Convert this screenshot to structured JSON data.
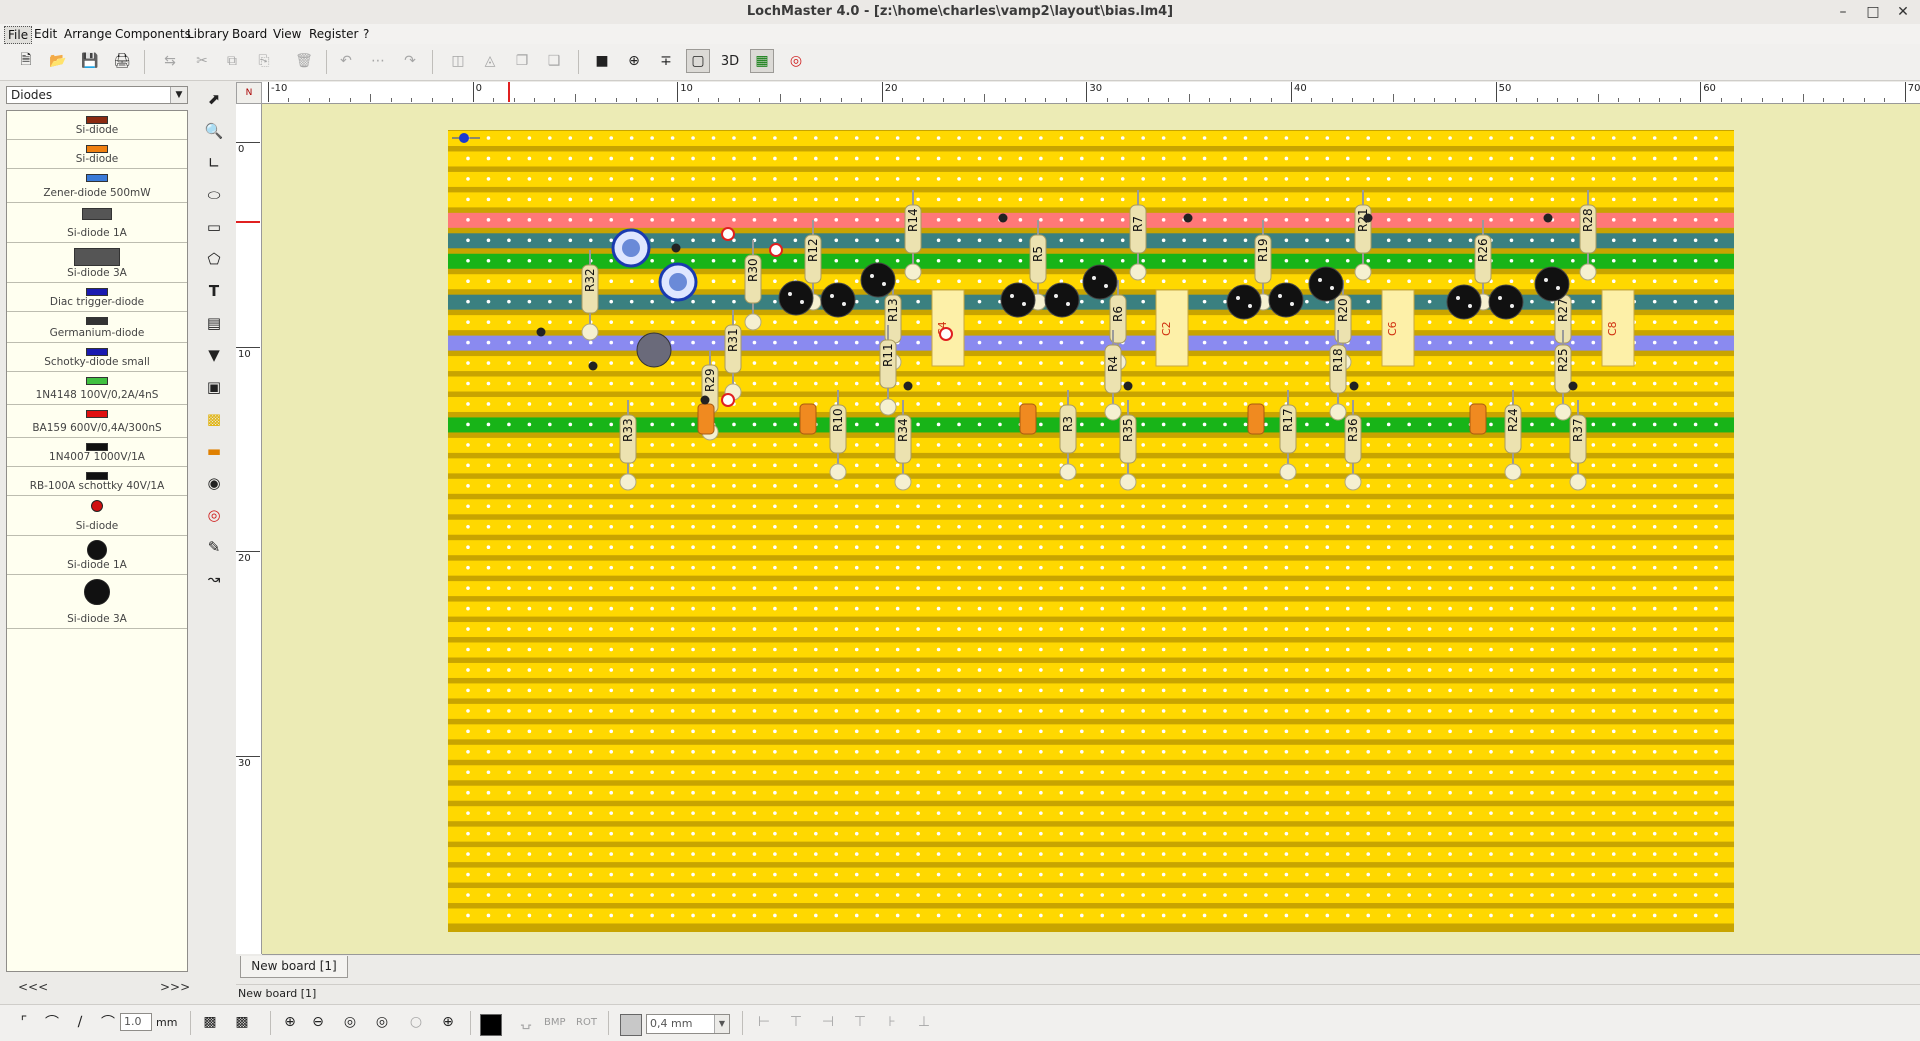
{
  "window": {
    "title": "LochMaster 4.0 - [z:\\home\\charles\\vamp2\\layout\\bias.lm4]",
    "minimize": "–",
    "restore": "□",
    "close": "✕"
  },
  "menu": [
    "File",
    "Edit",
    "Arrange",
    "Components",
    "Library",
    "Board",
    "View",
    "Register",
    "?"
  ],
  "toolbar": {
    "three_d_label": "3D"
  },
  "library": {
    "category": "Diodes",
    "items": [
      {
        "ref": "D1",
        "label": "Si-diode",
        "color": "#8b2a10"
      },
      {
        "ref": "D2",
        "label": "Si-diode",
        "color": "#f08010"
      },
      {
        "ref": "D3",
        "label": "Zener-diode 500mW",
        "color": "#3a7ad8"
      },
      {
        "ref": "D4",
        "label": "Si-diode 1A",
        "color": "#555555"
      },
      {
        "ref": "D5",
        "label": "Si-diode 3A",
        "color": "#555555"
      },
      {
        "ref": "D6",
        "label": "Diac trigger-diode",
        "color": "#1a1ab0"
      },
      {
        "ref": "D7",
        "label": "Germanium-diode",
        "color": "#333333"
      },
      {
        "ref": "D8",
        "label": "Schotky-diode small",
        "color": "#1a1ab0"
      },
      {
        "ref": "D9",
        "label": "1N4148  100V/0,2A/4nS",
        "color": "#40c040"
      },
      {
        "ref": "D10",
        "label": "BA159 600V/0,4A/300nS",
        "color": "#e01010"
      },
      {
        "ref": "D11",
        "label": "1N4007 1000V/1A",
        "color": "#111111"
      },
      {
        "ref": "D12",
        "label": "RB-100A schottky  40V/1A",
        "color": "#111111"
      },
      {
        "ref": "D13",
        "label": "Si-diode",
        "color": "#d01010"
      },
      {
        "ref": "D14",
        "label": "Si-diode 1A",
        "color": "#111111"
      },
      {
        "ref": "D15",
        "label": "Si-diode 3A",
        "color": "#111111"
      }
    ],
    "nav_prev": "<<<",
    "nav_next": ">>>"
  },
  "ruler": {
    "corner": "N",
    "h_ticks": [
      "-10",
      "0",
      "10",
      "20",
      "30",
      "40",
      "50",
      "60",
      "70"
    ],
    "v_ticks": [
      "0",
      "10",
      "20",
      "30"
    ]
  },
  "board": {
    "strip_colors": {
      "yellow": "#ffd800",
      "pink": "#ff7878",
      "teal": "#3a8080",
      "green": "#18b418",
      "violet": "#8a8af0",
      "base": "#c8a400",
      "dot": "#ffffff"
    },
    "resistors": [
      "R32",
      "R30",
      "R31",
      "R29",
      "R33",
      "R12",
      "R13",
      "R14",
      "R11",
      "R10",
      "R34",
      "R5",
      "R6",
      "R7",
      "R4",
      "R3",
      "R35",
      "R19",
      "R20",
      "R21",
      "R18",
      "R17",
      "R36",
      "R26",
      "R27",
      "R28",
      "R25",
      "R24",
      "R37"
    ],
    "film_caps": [
      "C4",
      "C2",
      "C6",
      "C8"
    ],
    "cap_value": "?",
    "transistor_marking": "BC\nX×X"
  },
  "tabs": [
    {
      "label": "New board [1]"
    }
  ],
  "status": {
    "text": "New board [1]"
  },
  "bottom": {
    "line_width": "1.0",
    "line_unit": "mm",
    "bmp_label": "BMP",
    "rot_label": "ROT",
    "grid_value": "0,4 mm"
  }
}
